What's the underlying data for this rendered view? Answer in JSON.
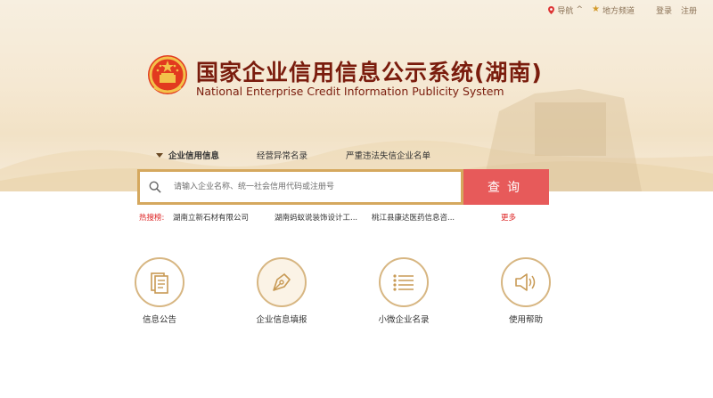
{
  "topbar": {
    "nav_label": "导航",
    "nav_caret": "^",
    "local_channel_label": "地方频道",
    "login_label": "登录",
    "register_label": "注册"
  },
  "header": {
    "title_cn": "国家企业信用信息公示系统(湖南)",
    "title_en": "National Enterprise Credit Information Publicity System"
  },
  "tabs": [
    {
      "label": "企业信用信息",
      "active": true
    },
    {
      "label": "经营异常名录",
      "active": false
    },
    {
      "label": "严重违法失信企业名单",
      "active": false
    }
  ],
  "search": {
    "placeholder": "请输入企业名称、统一社会信用代码或注册号",
    "button_label": "查询"
  },
  "hot_search": {
    "label": "热搜榜:",
    "items": [
      "湖南立新石材有限公司",
      "湖南蚂蚁说装饰设计工...",
      "桃江县康达医药信息咨..."
    ],
    "more_label": "更多"
  },
  "features": [
    {
      "label": "信息公告",
      "icon": "document-icon"
    },
    {
      "label": "企业信息填报",
      "icon": "pen-nib-icon"
    },
    {
      "label": "小微企业名录",
      "icon": "list-icon"
    },
    {
      "label": "使用帮助",
      "icon": "speaker-icon"
    }
  ],
  "colors": {
    "brand_red": "#7a1c0d",
    "search_button": "#e75a5a",
    "gold_border": "#d5a85e",
    "hot_label": "#dd2222"
  }
}
